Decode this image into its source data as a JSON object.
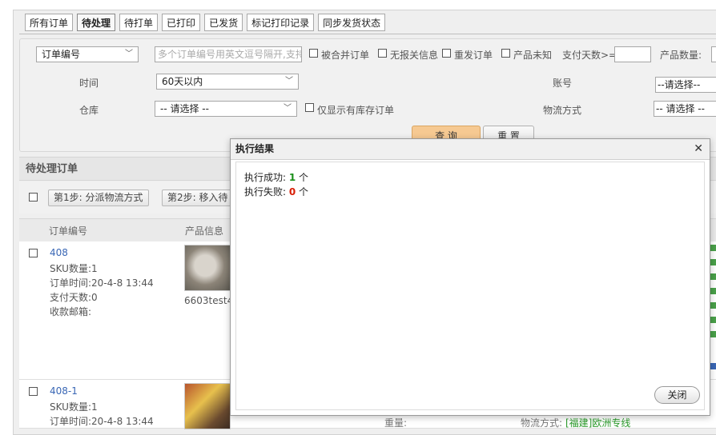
{
  "tabs": [
    "所有订单",
    "待处理",
    "待打单",
    "已打印",
    "已发货",
    "标记打印记录",
    "同步发货状态"
  ],
  "filter": {
    "field_select": "订单编号",
    "order_input_placeholder": "多个订单编号用英文逗号隔开,支持",
    "checks": [
      "被合并订单",
      "无报关信息",
      "重发订单",
      "产品未知"
    ],
    "pay_days_label": "支付天数>=",
    "qty_label": "产品数量:",
    "time_label": "时间",
    "time_value": "60天以内",
    "account_label": "账号",
    "account_value": "--请选择--",
    "warehouse_label": "仓库",
    "warehouse_value": "-- 请选择 --",
    "stock_only_label": "仅显示有库存订单",
    "shipping_label": "物流方式",
    "shipping_value": "-- 请选择 --",
    "query_btn": "查 询",
    "reset_btn": "重 置"
  },
  "section": {
    "title": "待处理订单",
    "step1": "第1步: 分派物流方式",
    "step2": "第2步: 移入待",
    "col_order": "订单编号",
    "col_product": "产品信息"
  },
  "orders": [
    {
      "id": "408",
      "sku": "SKU数量:1",
      "time": "订单时间:20-4-8 13:44",
      "paydays": "支付天数:0",
      "email": "收款邮箱:",
      "product": "6603test4"
    },
    {
      "id": "408-1",
      "sku": "SKU数量:1",
      "time": "订单时间:20-4-8 13:44"
    }
  ],
  "bottom_partial": {
    "left": "重量:",
    "right_prefix": "物流方式:",
    "right_value": "[福建]欧洲专线"
  },
  "modal": {
    "title": "执行结果",
    "success_label": "执行成功: ",
    "success_count": "1",
    "success_unit": " 个",
    "fail_label": "执行失败: ",
    "fail_count": "0",
    "fail_unit": " 个",
    "close_btn": "关闭"
  },
  "colors": {
    "success": "#1a8f1a",
    "fail": "#d81e06",
    "link": "#3a67b5",
    "accent": "#f5c28a"
  }
}
